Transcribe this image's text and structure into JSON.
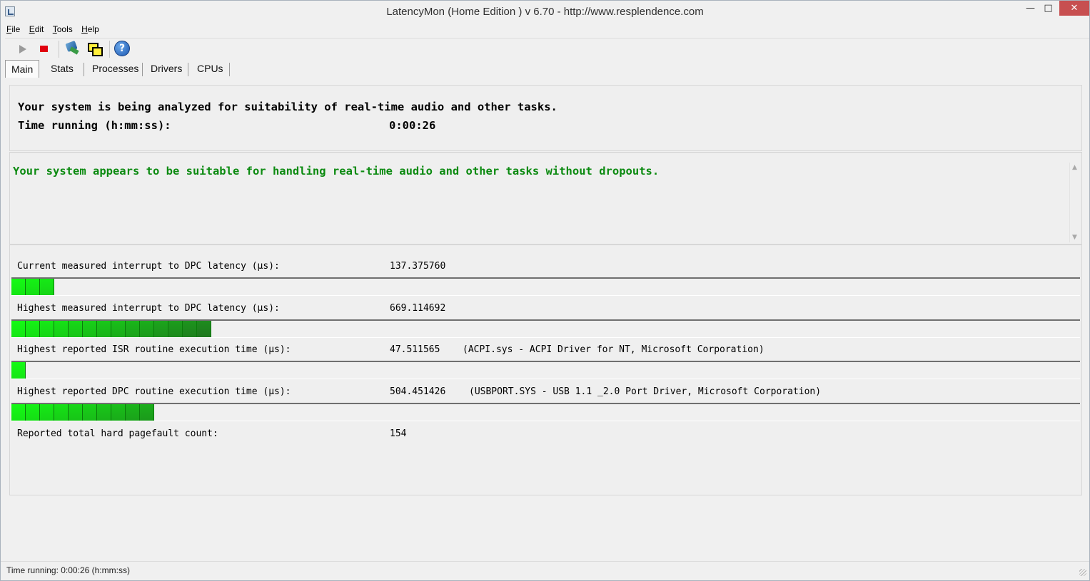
{
  "window": {
    "title": "LatencyMon  (Home Edition )  v 6.70 - http://www.resplendence.com",
    "min_glyph": "—",
    "max_glyph": "□",
    "close_glyph": "✕"
  },
  "menu": [
    {
      "first": "F",
      "rest": "ile"
    },
    {
      "first": "E",
      "rest": "dit"
    },
    {
      "first": "T",
      "rest": "ools"
    },
    {
      "first": "H",
      "rest": "elp"
    }
  ],
  "toolbar": {
    "icons": [
      "play-icon",
      "stop-icon",
      "driver-icon",
      "windows-icon",
      "help-icon"
    ]
  },
  "tabs": [
    "Main",
    "Stats",
    "Processes",
    "Drivers",
    "CPUs"
  ],
  "main": {
    "analyze_text": "Your system is being analyzed for suitability of real-time audio and other tasks.",
    "time_label": "Time running (h:mm:ss):",
    "time_value": "0:00:26",
    "verdict": "Your system appears to be suitable for handling real-time audio and other tasks without dropouts.",
    "metrics": [
      {
        "label": "Current measured interrupt to DPC latency (µs):",
        "value": "137.375760",
        "desc": "",
        "segments": 3
      },
      {
        "label": "Highest measured interrupt to DPC latency (µs):",
        "value": "669.114692",
        "desc": "",
        "segments": 14
      },
      {
        "label": "Highest reported ISR routine execution time (µs):",
        "value": "47.511565",
        "desc": "(ACPI.sys - ACPI Driver for NT, Microsoft Corporation)",
        "segments": 1
      },
      {
        "label": "Highest reported DPC routine execution time (µs):",
        "value": "504.451426",
        "desc": "(USBPORT.SYS - USB 1.1 _2.0 Port Driver, Microsoft Corporation)",
        "segments": 10
      }
    ],
    "pagefault_label": "Reported total hard pagefault count:",
    "pagefault_value": "154"
  },
  "status": {
    "text": "Time running: 0:00:26  (h:mm:ss)"
  },
  "colors": {
    "verdict_green": "#0b8a10",
    "close_red": "#c74f50"
  }
}
